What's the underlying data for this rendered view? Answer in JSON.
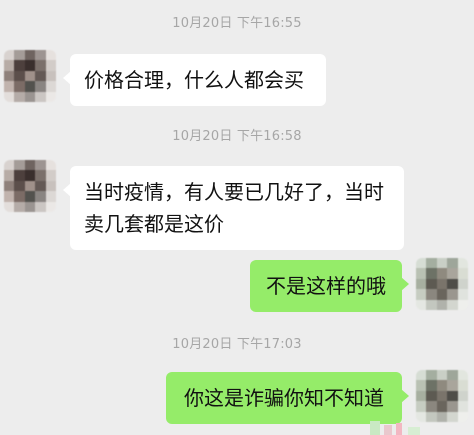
{
  "chat": {
    "messages": [
      {
        "type": "time",
        "text": "10月20日 下午16:55"
      },
      {
        "type": "msg",
        "side": "left",
        "text": "价格合理，什么人都会买"
      },
      {
        "type": "time",
        "text": "10月20日 下午16:58"
      },
      {
        "type": "msg",
        "side": "left",
        "text": "当时疫情，有人要已几好了，当时卖几套都是这价"
      },
      {
        "type": "msg",
        "side": "right",
        "text": "不是这样的哦"
      },
      {
        "type": "time",
        "text": "10月20日 下午17:03"
      },
      {
        "type": "msg",
        "side": "right",
        "text": "你这是诈骗你知不知道"
      }
    ]
  },
  "colors": {
    "background": "#ededed",
    "bubble_left": "#ffffff",
    "bubble_right": "#95ec69",
    "timestamp": "#a6a6a6"
  },
  "avatars": {
    "contact": "avatar-pixelated",
    "self": "avatar-pixelated"
  }
}
